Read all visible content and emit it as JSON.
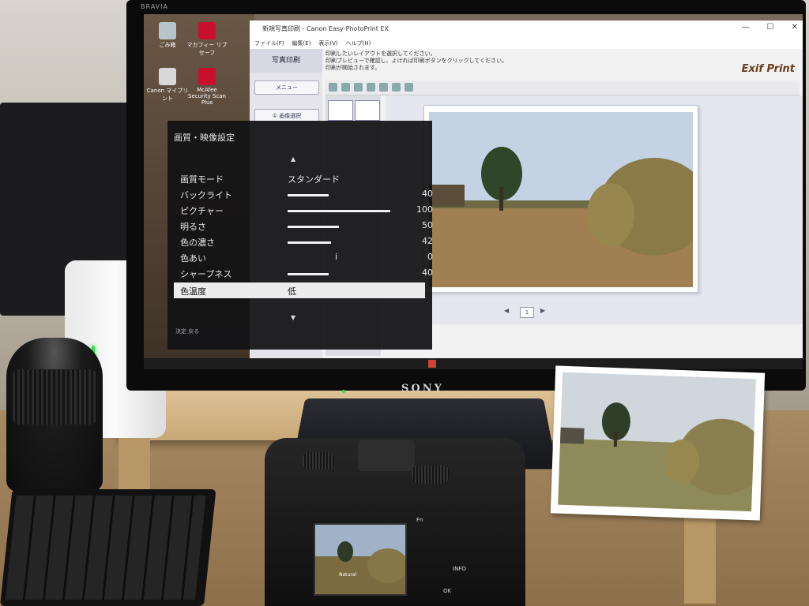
{
  "monitor": {
    "model": "BRAVIA",
    "brand": "SONY"
  },
  "desktop_icons": [
    {
      "label": "ごみ箱",
      "icon": "trash-icon"
    },
    {
      "label": "マカフィー リブセーフ",
      "icon": "mcafee-icon"
    },
    {
      "label": "Canon マイプリント",
      "icon": "printer-icon"
    },
    {
      "label": "McAfee Security Scan Plus",
      "icon": "mcafee-scan-icon"
    }
  ],
  "app": {
    "title": "新規写真印刷 - Canon Easy-PhotoPrint EX",
    "menu": [
      "ファイル(F)",
      "編集(E)",
      "表示(V)",
      "ヘルプ(H)"
    ],
    "window_buttons": [
      "—",
      "☐",
      "✕"
    ],
    "left_pane_title": "写真印刷",
    "left_pane_buttons": [
      "メニュー",
      "① 画像選択"
    ],
    "instructions": [
      "印刷したいレイアウトを選択してください。",
      "印刷プレビューで確認し、よければ印刷ボタンをクリックしてください。",
      "印刷が開始されます。"
    ],
    "logo": "Exif Print",
    "page_number": "1"
  },
  "osd": {
    "title": "画質・映像設定",
    "rows": [
      {
        "label": "画質モード",
        "value": "スタンダード",
        "kind": "text"
      },
      {
        "label": "バックライト",
        "value": "40",
        "level": 0.4,
        "kind": "bar"
      },
      {
        "label": "ピクチャー",
        "value": "100",
        "level": 1.0,
        "kind": "bar"
      },
      {
        "label": "明るさ",
        "value": "50",
        "level": 0.5,
        "kind": "bar"
      },
      {
        "label": "色の濃さ",
        "value": "42",
        "level": 0.42,
        "kind": "bar"
      },
      {
        "label": "色あい",
        "value": "0",
        "level": 0.0,
        "kind": "center"
      },
      {
        "label": "シャープネス",
        "value": "40",
        "level": 0.4,
        "kind": "bar"
      },
      {
        "label": "色温度",
        "value": "低",
        "kind": "selected"
      }
    ],
    "footer": "決定 戻る"
  },
  "camera": {
    "lcd_label": "Natural",
    "buttons": [
      "Fn",
      "INFO",
      "OK"
    ]
  },
  "colors": {
    "osd_bg": "#121214",
    "sky": "#c9d6e6",
    "grass": "#9a7d4c",
    "app_accent": "#6b3a1a"
  }
}
